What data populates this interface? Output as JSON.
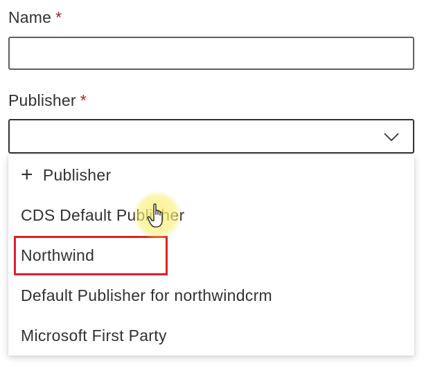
{
  "form": {
    "name_label": "Name",
    "name_required": "*",
    "name_value": "",
    "publisher_label": "Publisher",
    "publisher_required": "*",
    "publisher_value": ""
  },
  "dropdown": {
    "add_icon": "plus-icon",
    "add_label": "Publisher",
    "options": [
      "CDS Default Publisher",
      "Northwind",
      "Default Publisher for northwindcrm",
      "Microsoft First Party"
    ],
    "highlighted_option": "Northwind"
  },
  "colors": {
    "required": "#a4262c",
    "highlight": "#e02020",
    "cursor_glow": "#faf078"
  },
  "icons": {
    "chevron": "chevron-down-icon",
    "cursor": "hand-pointer-icon"
  }
}
